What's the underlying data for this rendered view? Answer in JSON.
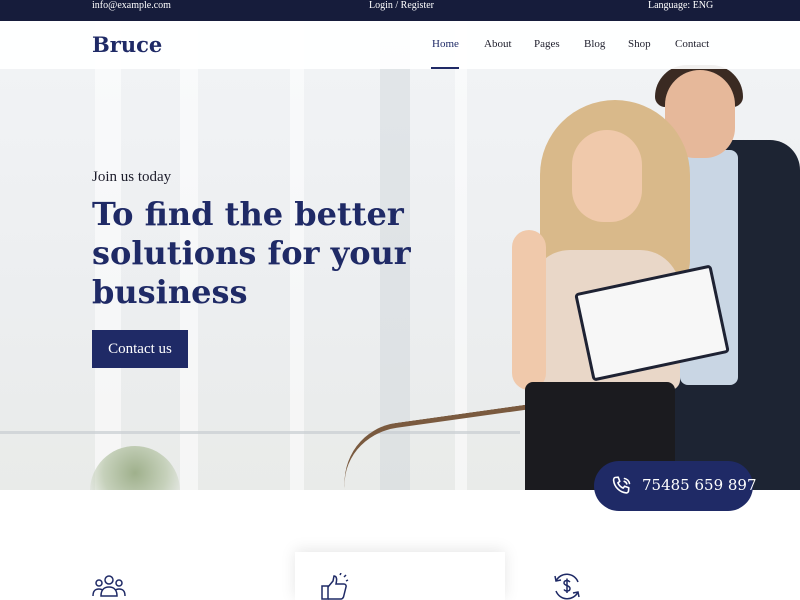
{
  "topbar": {
    "email": "info@example.com",
    "login_register": "Login / Register",
    "language": "Language: ENG"
  },
  "brand": {
    "logo": "Bruce"
  },
  "nav": {
    "items": [
      {
        "label": "Home",
        "active": true
      },
      {
        "label": "About"
      },
      {
        "label": "Pages"
      },
      {
        "label": "Blog"
      },
      {
        "label": "Shop"
      },
      {
        "label": "Contact"
      }
    ]
  },
  "hero": {
    "eyebrow": "Join us today",
    "headline": "To find the better solutions for your business",
    "cta_label": "Contact us"
  },
  "contact": {
    "phone": "75485 659 897",
    "icon": "phone-icon"
  },
  "features": {
    "icons": [
      "team-icon",
      "thumbs-up-icon",
      "money-cycle-icon"
    ]
  },
  "colors": {
    "brand": "#1f2a66",
    "topbar": "#161c3b"
  }
}
